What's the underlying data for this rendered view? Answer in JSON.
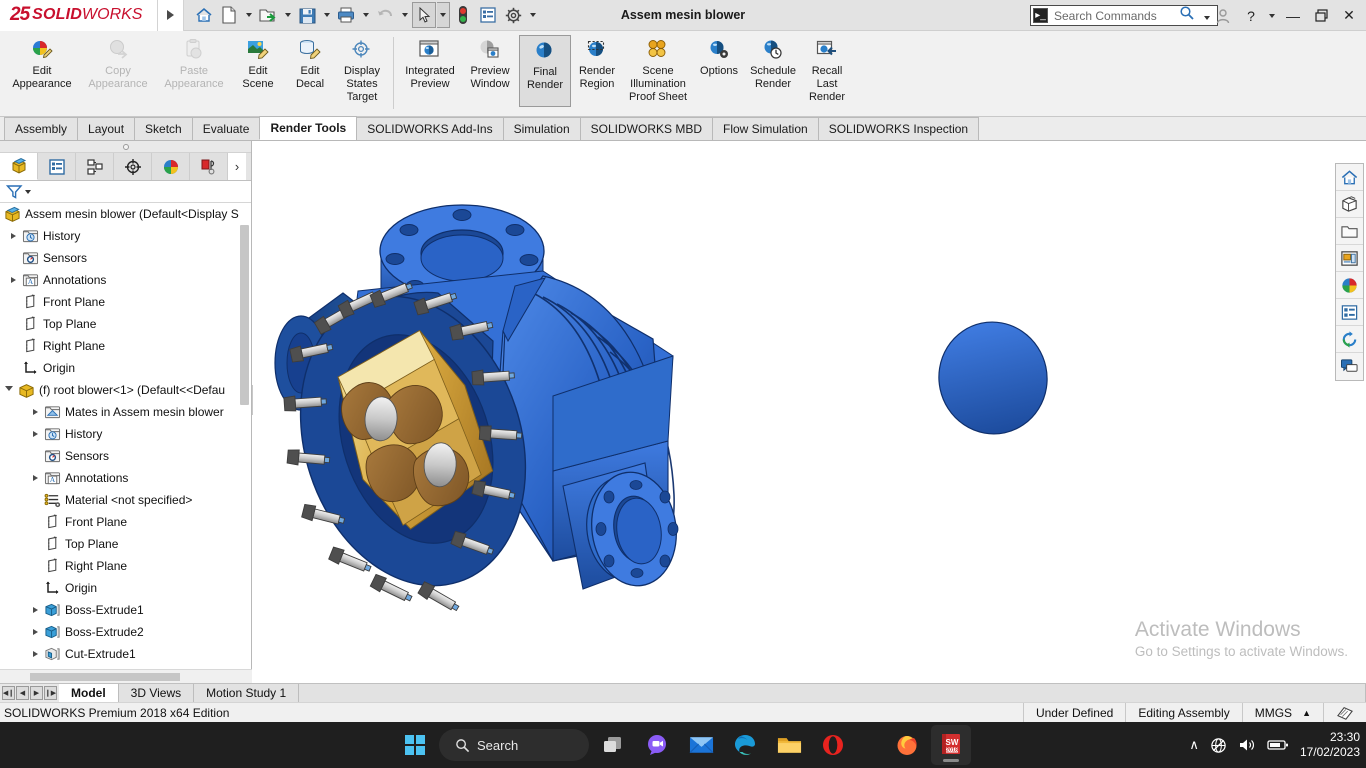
{
  "titlebar": {
    "logo_ds": "25",
    "logo_solid": "SOLID",
    "logo_works": "WORKS",
    "document_title": "Assem mesin blower",
    "search_placeholder": "Search Commands",
    "quick_access": [
      {
        "name": "home-icon",
        "label": "Home"
      },
      {
        "name": "new-document-icon",
        "label": "New"
      },
      {
        "name": "open-folder-icon",
        "label": "Open"
      },
      {
        "name": "save-icon",
        "label": "Save"
      },
      {
        "name": "print-icon",
        "label": "Print"
      },
      {
        "name": "undo-icon",
        "label": "Undo"
      },
      {
        "name": "select-cursor-icon",
        "label": "Select"
      },
      {
        "name": "rebuild-icon",
        "label": "Rebuild"
      },
      {
        "name": "display-options-icon",
        "label": "Options"
      },
      {
        "name": "gear-icon",
        "label": "Settings"
      }
    ],
    "window_controls": {
      "minimize": "—",
      "restore": "❐",
      "close": "✕",
      "help": "?",
      "user": "user-icon"
    }
  },
  "ribbon": {
    "groups": [
      {
        "buttons": [
          {
            "label_top": "Edit",
            "label_bottom": "Appearance",
            "icon": "edit-appearance-icon",
            "state": "enabled"
          },
          {
            "label_top": "Copy",
            "label_bottom": "Appearance",
            "icon": "copy-appearance-icon",
            "state": "disabled"
          },
          {
            "label_top": "Paste",
            "label_bottom": "Appearance",
            "icon": "paste-appearance-icon",
            "state": "disabled"
          },
          {
            "label_top": "Edit",
            "label_bottom": "Scene",
            "icon": "edit-scene-icon",
            "state": "enabled"
          },
          {
            "label_top": "Edit",
            "label_bottom": "Decal",
            "icon": "edit-decal-icon",
            "state": "enabled"
          },
          {
            "label_top": "Display",
            "label_bottom": "States Target",
            "icon": "display-states-target-icon",
            "state": "enabled"
          }
        ]
      },
      {
        "buttons": [
          {
            "label_top": "Integrated",
            "label_bottom": "Preview",
            "icon": "integrated-preview-icon",
            "state": "enabled"
          },
          {
            "label_top": "Preview",
            "label_bottom": "Window",
            "icon": "preview-window-icon",
            "state": "enabled"
          },
          {
            "label_top": "Final",
            "label_bottom": "Render",
            "icon": "final-render-icon",
            "state": "active"
          },
          {
            "label_top": "Render",
            "label_bottom": "Region",
            "icon": "render-region-icon",
            "state": "enabled"
          },
          {
            "label_top": "Scene",
            "label_bottom": "Illumination Proof Sheet",
            "icon": "scene-illumination-icon",
            "state": "enabled"
          },
          {
            "label_top": "Options",
            "label_bottom": "",
            "icon": "render-options-icon",
            "state": "enabled"
          },
          {
            "label_top": "Schedule",
            "label_bottom": "Render",
            "icon": "schedule-render-icon",
            "state": "enabled"
          },
          {
            "label_top": "Recall",
            "label_bottom": "Last Render",
            "icon": "recall-last-render-icon",
            "state": "enabled"
          }
        ]
      }
    ]
  },
  "command_tabs": {
    "items": [
      {
        "label": "Assembly",
        "active": false
      },
      {
        "label": "Layout",
        "active": false
      },
      {
        "label": "Sketch",
        "active": false
      },
      {
        "label": "Evaluate",
        "active": false
      },
      {
        "label": "Render Tools",
        "active": true
      },
      {
        "label": "SOLIDWORKS Add-Ins",
        "active": false
      },
      {
        "label": "Simulation",
        "active": false
      },
      {
        "label": "SOLIDWORKS MBD",
        "active": false
      },
      {
        "label": "Flow Simulation",
        "active": false
      },
      {
        "label": "SOLIDWORKS Inspection",
        "active": false
      }
    ]
  },
  "left_panel": {
    "tabs": [
      {
        "name": "feature-manager-tab",
        "icon": "feature-tree-icon",
        "active": true
      },
      {
        "name": "property-manager-tab",
        "icon": "property-list-icon",
        "active": false
      },
      {
        "name": "configuration-manager-tab",
        "icon": "configuration-icon",
        "active": false
      },
      {
        "name": "dimxpert-manager-tab",
        "icon": "dimxpert-icon",
        "active": false
      },
      {
        "name": "display-manager-tab",
        "icon": "display-palette-icon",
        "active": false
      },
      {
        "name": "render-manager-tab",
        "icon": "render-manager-icon",
        "active": false
      }
    ],
    "more_tabs_label": "›",
    "filter_icon": "filter-icon",
    "tree": [
      {
        "label": "Assem mesin blower  (Default<Display S",
        "icon": "assembly-icon",
        "indent": 0,
        "arrow": "none",
        "root": true
      },
      {
        "label": "History",
        "icon": "history-folder-icon",
        "indent": 1,
        "arrow": "right"
      },
      {
        "label": "Sensors",
        "icon": "sensors-folder-icon",
        "indent": 1,
        "arrow": "none"
      },
      {
        "label": "Annotations",
        "icon": "annotations-folder-icon",
        "indent": 1,
        "arrow": "right"
      },
      {
        "label": "Front Plane",
        "icon": "plane-icon",
        "indent": 1,
        "arrow": "none"
      },
      {
        "label": "Top Plane",
        "icon": "plane-icon",
        "indent": 1,
        "arrow": "none"
      },
      {
        "label": "Right Plane",
        "icon": "plane-icon",
        "indent": 1,
        "arrow": "none"
      },
      {
        "label": "Origin",
        "icon": "origin-icon",
        "indent": 1,
        "arrow": "none"
      },
      {
        "label": "(f) root blower<1>  (Default<<Defau",
        "icon": "part-icon",
        "indent": 0,
        "arrow": "down"
      },
      {
        "label": "Mates in Assem mesin blower",
        "icon": "mates-folder-icon",
        "indent": 2,
        "arrow": "right"
      },
      {
        "label": "History",
        "icon": "history-folder-icon",
        "indent": 2,
        "arrow": "right"
      },
      {
        "label": "Sensors",
        "icon": "sensors-folder-icon",
        "indent": 2,
        "arrow": "none"
      },
      {
        "label": "Annotations",
        "icon": "annotations-folder-icon",
        "indent": 2,
        "arrow": "right"
      },
      {
        "label": "Material <not specified>",
        "icon": "material-icon",
        "indent": 2,
        "arrow": "none"
      },
      {
        "label": "Front Plane",
        "icon": "plane-icon",
        "indent": 2,
        "arrow": "none"
      },
      {
        "label": "Top Plane",
        "icon": "plane-icon",
        "indent": 2,
        "arrow": "none"
      },
      {
        "label": "Right Plane",
        "icon": "plane-icon",
        "indent": 2,
        "arrow": "none"
      },
      {
        "label": "Origin",
        "icon": "origin-icon",
        "indent": 2,
        "arrow": "none"
      },
      {
        "label": "Boss-Extrude1",
        "icon": "boss-extrude-icon",
        "indent": 2,
        "arrow": "right"
      },
      {
        "label": "Boss-Extrude2",
        "icon": "boss-extrude-icon",
        "indent": 2,
        "arrow": "right"
      },
      {
        "label": "Cut-Extrude1",
        "icon": "cut-extrude-icon",
        "indent": 2,
        "arrow": "right"
      }
    ]
  },
  "view_toolbar": {
    "buttons": [
      {
        "name": "view-home-button",
        "icon": "home-icon"
      },
      {
        "name": "view-orientation-button",
        "icon": "view-orientation-icon"
      },
      {
        "name": "view-open-button",
        "icon": "folder-icon"
      },
      {
        "name": "display-style-button",
        "icon": "display-style-icon"
      },
      {
        "name": "appearances-button",
        "icon": "appearance-sphere-icon"
      },
      {
        "name": "scene-settings-button",
        "icon": "scene-list-icon"
      },
      {
        "name": "view-refresh-button",
        "icon": "refresh-icon"
      },
      {
        "name": "comments-button",
        "icon": "comment-icon"
      }
    ]
  },
  "model": {
    "name": "root-blower-3d-model",
    "colors": {
      "housing_blue": "#1f5fc0",
      "housing_blue_light": "#3b7fe0",
      "housing_blue_dark": "#143f86",
      "rotor_bronze": "#9a6b33",
      "rotor_gold": "#d9a93f",
      "bolt_steel": "#b9b9b9",
      "bolt_dark": "#4f4f4f"
    }
  },
  "watermark": {
    "line1": "Activate Windows",
    "line2": "Go to Settings to activate Windows."
  },
  "bottom_tabs": {
    "nav": [
      "◀❙",
      "◀",
      "▶",
      "❙▶"
    ],
    "items": [
      {
        "label": "Model",
        "active": true
      },
      {
        "label": "3D Views",
        "active": false
      },
      {
        "label": "Motion Study 1",
        "active": false
      }
    ]
  },
  "status_bar": {
    "edition": "SOLIDWORKS Premium 2018 x64 Edition",
    "definition_state": "Under Defined",
    "edit_mode": "Editing Assembly",
    "units": "MMGS",
    "units_caret": "▲",
    "overlay_icon": "sheet-icon"
  },
  "taskbar": {
    "start_label": "start-button",
    "search_label": "Search",
    "apps": [
      {
        "name": "task-view-icon",
        "label": "Task View"
      },
      {
        "name": "chat-icon",
        "label": "Chat"
      },
      {
        "name": "mail-icon",
        "label": "Mail"
      },
      {
        "name": "edge-icon",
        "label": "Microsoft Edge"
      },
      {
        "name": "file-explorer-icon",
        "label": "File Explorer"
      },
      {
        "name": "opera-icon",
        "label": "Opera"
      },
      {
        "name": "firefox-icon",
        "label": "Firefox"
      },
      {
        "name": "solidworks-taskbar-icon",
        "label": "SOLIDWORKS 2018"
      }
    ],
    "sw_badge_year": "2018",
    "sw_badge_text": "SW",
    "tray": {
      "chevron": "∧",
      "network_icon": "network-offline-icon",
      "volume_icon": "volume-icon",
      "battery_icon": "battery-icon",
      "time": "23:30",
      "date": "17/02/2023"
    }
  }
}
